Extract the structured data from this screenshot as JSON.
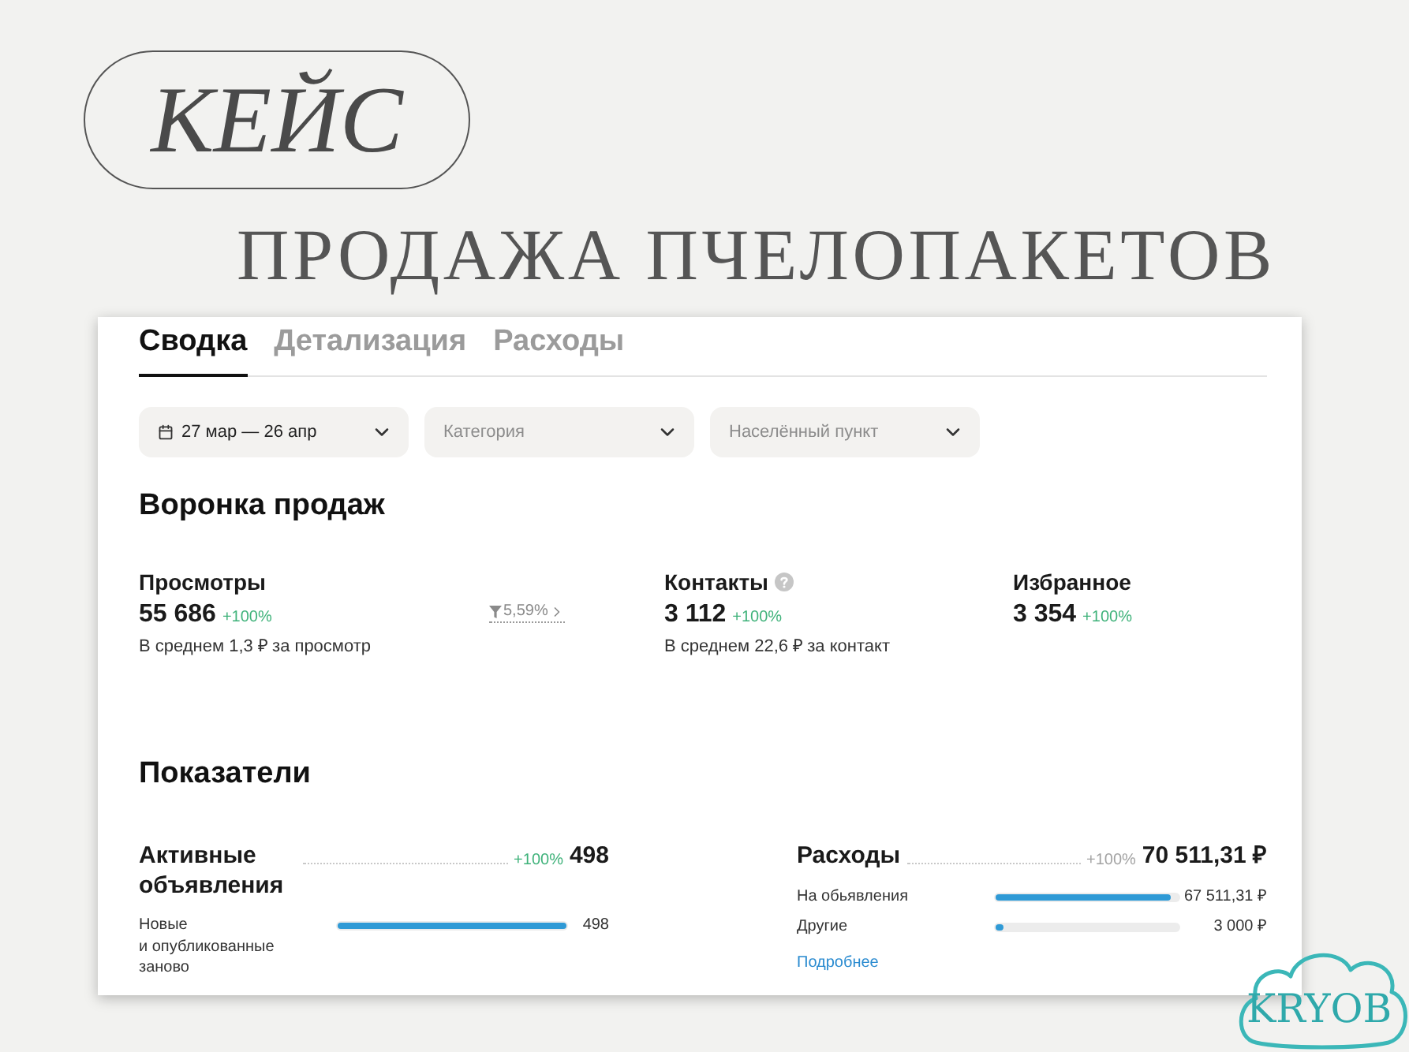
{
  "slide": {
    "badge": "КЕЙС",
    "title": "ПРОДАЖА ПЧЕЛОПАКЕТОВ",
    "logo": "KRYOB"
  },
  "tabs": [
    {
      "label": "Сводка",
      "selected": true
    },
    {
      "label": "Детализация",
      "selected": false
    },
    {
      "label": "Расходы",
      "selected": false
    }
  ],
  "filters": [
    {
      "kind": "date",
      "value": "27 мар — 26 апр"
    },
    {
      "kind": "select",
      "placeholder": "Категория"
    },
    {
      "kind": "select",
      "placeholder": "Населённый пункт"
    }
  ],
  "funnel": {
    "title": "Воронка продаж",
    "metrics": [
      {
        "label": "Просмотры",
        "help": false,
        "value": "55 686",
        "change": "+100%",
        "note": "В среднем 1,3 ₽ за просмотр"
      },
      {
        "label": "Контакты",
        "help": true,
        "value": "3 112",
        "change": "+100%",
        "note": "В среднем 22,6 ₽ за контакт"
      },
      {
        "label": "Избранное",
        "help": false,
        "value": "3 354",
        "change": "+100%"
      }
    ],
    "conversion": "5,59%"
  },
  "indicators": {
    "title": "Показатели",
    "panels": [
      {
        "title": "Активные объявления",
        "kind": "positive",
        "change": "+100%",
        "total": "498",
        "rows": [
          {
            "label": "Новые и опубликованные заново",
            "level": 1,
            "value": "498"
          }
        ]
      },
      {
        "title": "Расходы",
        "kind": "neutral",
        "change": "+100%",
        "total": "70 511,31 ₽",
        "rows": [
          {
            "label": "На обьявления",
            "level": 0.96,
            "value": "67 511,31 ₽"
          },
          {
            "label": "Другие",
            "level": 0.04,
            "value": "3 000 ₽"
          }
        ],
        "link": "Подробнее"
      }
    ]
  }
}
